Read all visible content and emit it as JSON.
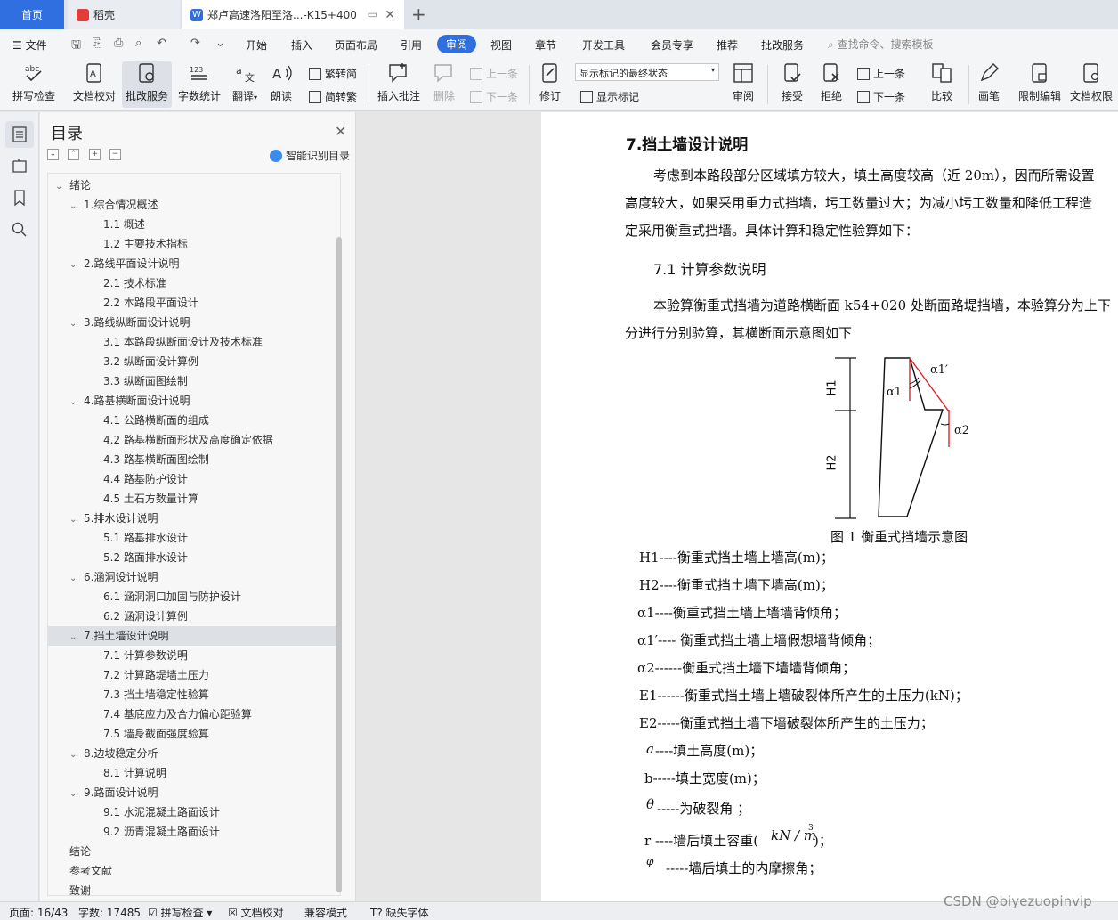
{
  "tabs": {
    "home": "首页",
    "daoke": "稻壳",
    "doc": "郑卢高速洛阳至洛...-K15+400"
  },
  "menu": {
    "file": "文件",
    "items": [
      "开始",
      "插入",
      "页面布局",
      "引用",
      "审阅",
      "视图",
      "章节",
      "开发工具",
      "会员专享",
      "推荐",
      "批改服务"
    ],
    "active": "审阅",
    "search": "查找命令、搜索模板"
  },
  "ribbon": {
    "spell": "拼写检查",
    "proof": "文档校对",
    "correct": "批改服务",
    "count": "字数统计",
    "translate": "翻译",
    "read": "朗读",
    "trad_to_simp": "繁转简",
    "simp_to_trad": "简转繁",
    "insert_comment": "插入批注",
    "delete": "删除",
    "prev": "上一条",
    "next": "下一条",
    "revise": "修订",
    "markup_state": "显示标记的最终状态",
    "show_markup": "显示标记",
    "review": "审阅",
    "accept": "接受",
    "reject": "拒绝",
    "prev2": "上一条",
    "next2": "下一条",
    "compare": "比较",
    "pen": "画笔",
    "restrict": "限制编辑",
    "permission": "文档权限"
  },
  "toc": {
    "title": "目录",
    "smart": "智能识别目录",
    "items": [
      {
        "level": 0,
        "caret": "down",
        "text": "绪论"
      },
      {
        "level": 1,
        "caret": "down",
        "text": "1.综合情况概述"
      },
      {
        "level": 2,
        "text": "1.1 概述"
      },
      {
        "level": 2,
        "text": "1.2  主要技术指标"
      },
      {
        "level": 1,
        "caret": "down",
        "text": "2.路线平面设计说明"
      },
      {
        "level": 2,
        "text": "2.1  技术标准"
      },
      {
        "level": 2,
        "text": "2.2  本路段平面设计"
      },
      {
        "level": 1,
        "caret": "down",
        "text": "3.路线纵断面设计说明"
      },
      {
        "level": 2,
        "text": "3.1  本路段纵断面设计及技术标准"
      },
      {
        "level": 2,
        "text": "3.2  纵断面设计算例"
      },
      {
        "level": 2,
        "text": "3.3  纵断面图绘制"
      },
      {
        "level": 1,
        "caret": "down",
        "text": "4.路基横断面设计说明"
      },
      {
        "level": 2,
        "text": "4.1  公路横断面的组成"
      },
      {
        "level": 2,
        "text": "4.2  路基横断面形状及高度确定依据"
      },
      {
        "level": 2,
        "text": "4.3  路基横断面图绘制"
      },
      {
        "level": 2,
        "text": "4.4  路基防护设计"
      },
      {
        "level": 2,
        "text": "4.5  土石方数量计算"
      },
      {
        "level": 1,
        "caret": "down",
        "text": "5.排水设计说明"
      },
      {
        "level": 2,
        "text": "5.1  路基排水设计"
      },
      {
        "level": 2,
        "text": "5.2  路面排水设计"
      },
      {
        "level": 1,
        "caret": "down",
        "text": "6.涵洞设计说明"
      },
      {
        "level": 2,
        "text": "6.1  涵洞洞口加固与防护设计"
      },
      {
        "level": 2,
        "text": "6.2  涵洞设计算例"
      },
      {
        "level": 1,
        "caret": "down",
        "text": "7.挡土墙设计说明",
        "selected": true
      },
      {
        "level": 2,
        "text": "7.1  计算参数说明"
      },
      {
        "level": 2,
        "text": "7.2  计算路堤墙土压力"
      },
      {
        "level": 2,
        "text": "7.3  挡土墙稳定性验算"
      },
      {
        "level": 2,
        "text": "7.4  基底应力及合力偏心距验算"
      },
      {
        "level": 2,
        "text": "7.5  墙身截面强度验算"
      },
      {
        "level": 1,
        "caret": "down",
        "text": "8.边坡稳定分析"
      },
      {
        "level": 2,
        "text": "8.1 计算说明"
      },
      {
        "level": 1,
        "caret": "down",
        "text": "9.路面设计说明"
      },
      {
        "level": 2,
        "text": "9.1  水泥混凝土路面设计"
      },
      {
        "level": 2,
        "text": "9.2  沥青混凝土路面设计"
      },
      {
        "level": 0,
        "text": "结论"
      },
      {
        "level": 0,
        "text": "参考文献"
      },
      {
        "level": 0,
        "text": "致谢"
      }
    ]
  },
  "doc": {
    "heading": "7.挡土墙设计说明",
    "para1": [
      "考虑到本路段部分区域填方较大，填土高度较高（近 20m），因而所需设置",
      "高度较大，如果采用重力式挡墙，圬工数量过大；为减小圬工数量和降低工程造",
      "定采用衡重式挡墙。具体计算和稳定性验算如下："
    ],
    "sub": "7.1  计算参数说明",
    "para2": [
      "本验算衡重式挡墙为道路横断面 k54+020 处断面路堤挡墙，本验算分为上下",
      "分进行分别验算，其横断面示意图如下"
    ],
    "fig_labels": {
      "h1": "H1",
      "h2": "H2",
      "a1": "α1",
      "a1p": "α1′",
      "a2": "α2"
    },
    "caption": "图 1    衡重式挡墙示意图",
    "defs": [
      "H1----衡重式挡土墙上墙高(m)；",
      "H2----衡重式挡土墙下墙高(m)；",
      "α1----衡重式挡土墙上墙墙背倾角；",
      "α1′----  衡重式挡土墙上墙假想墙背倾角；",
      "α2------衡重式挡土墙下墙墙背倾角；",
      "E1------衡重式挡土墙上墙破裂体所产生的土压力(kN)；",
      "E2-----衡重式挡土墙下墙破裂体所产生的土压力；",
      "----填土高度(m)；",
      "b-----填土宽度(m)；",
      "-----为破裂角 ；",
      "r ----墙后填土容重(",
      "-----墙后填土的内摩擦角；"
    ],
    "sym_a": "a",
    "sym_theta": "θ",
    "unit": "kN / m",
    "unit_exp": "3",
    "unit_close": ")；",
    "sym_phi": "φ"
  },
  "status": {
    "page": "页面: 16/43",
    "words": "字数: 17485",
    "spell": "拼写检查",
    "proof": "文档校对",
    "compat": "兼容模式",
    "missing_font": "缺失字体"
  },
  "watermark": "CSDN @biyezuopinvip",
  "colors": {
    "accent": "#2f6fe0",
    "red_line": "#e0222a"
  }
}
